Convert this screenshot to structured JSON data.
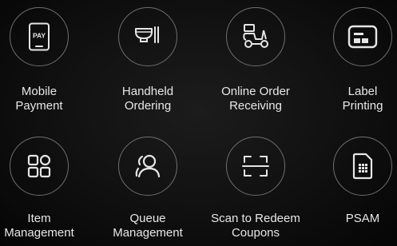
{
  "features": [
    {
      "icon": "mobile-pay-icon",
      "line1": "Mobile",
      "line2": "Payment",
      "pay_text": "PAY"
    },
    {
      "icon": "handheld-ordering-icon",
      "line1": "Handheld",
      "line2": "Ordering"
    },
    {
      "icon": "delivery-scooter-icon",
      "line1": "Online Order",
      "line2": "Receiving"
    },
    {
      "icon": "label-printer-icon",
      "line1": "Label",
      "line2": "Printing"
    },
    {
      "icon": "grid-apps-icon",
      "line1": "Item",
      "line2": "Management"
    },
    {
      "icon": "queue-people-icon",
      "line1": "Queue",
      "line2": "Management"
    },
    {
      "icon": "scan-frame-icon",
      "line1": "Scan to Redeem",
      "line2": "Coupons"
    },
    {
      "icon": "sim-card-icon",
      "line1": "PSAM",
      "line2": ""
    }
  ],
  "colors": {
    "background": "#0b0b0b",
    "circle_border": "#6f6f6f",
    "icon_stroke": "#e6e6e6",
    "text": "#e8e8e8"
  }
}
